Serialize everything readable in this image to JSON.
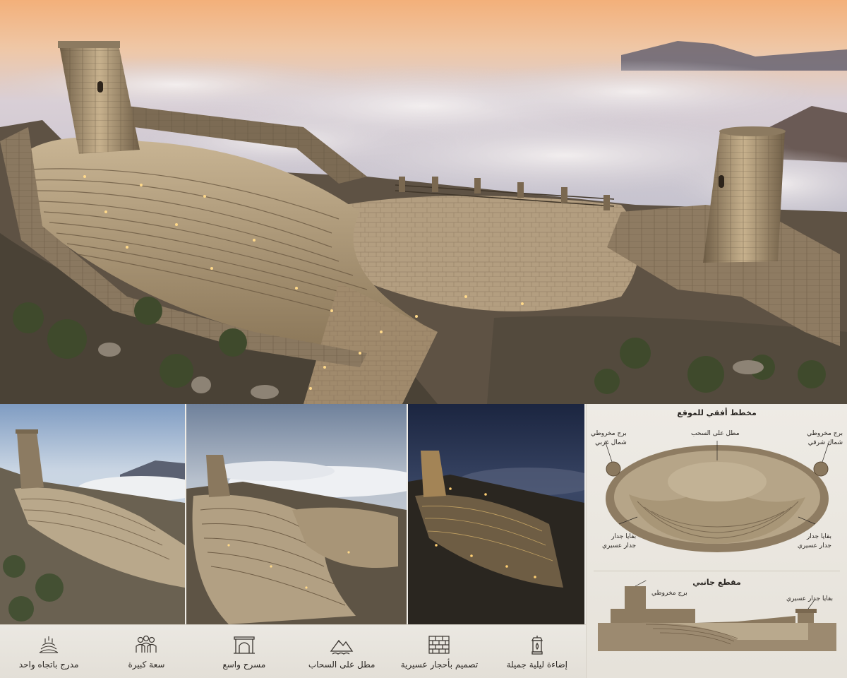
{
  "plan_panel": {
    "top_view_title": "مخطط أفقي للموقع",
    "tower_nw_label": [
      "برج مخروطي",
      "شمال غربي"
    ],
    "cloud_view_label": "مطل على السحب",
    "tower_ne_label": [
      "برج مخروطي",
      "شمال شرقي"
    ],
    "wall_left_label": [
      "بقايا جدار",
      "جدار عسيري"
    ],
    "wall_right_label": [
      "بقايا جدار",
      "جدار عسيري"
    ],
    "section_title": "مقطع جانبي",
    "section_tower_label": "برج مخروطي",
    "section_wall_label": "بقايا جدار عسيري"
  },
  "features": [
    {
      "icon": "lantern-icon",
      "label": "إضاءة ليلية جميلة"
    },
    {
      "icon": "stone-wall-icon",
      "label": "تصميم بأحجار عسيرية"
    },
    {
      "icon": "mountain-clouds-icon",
      "label": "مطل على السحاب"
    },
    {
      "icon": "stage-arch-icon",
      "label": "مسرح واسع"
    },
    {
      "icon": "audience-icon",
      "label": "سعة كبيرة"
    },
    {
      "icon": "amphitheater-icon",
      "label": "مدرج باتجاه واحد"
    }
  ],
  "colors": {
    "stone": "#b59e7e",
    "stone_dark": "#6e5c46",
    "sunset_top": "#f2b27c",
    "cloud": "#e9e4e4",
    "night_sky": "#1f2a44",
    "panel_bg": "#eeebe5",
    "text": "#2a2622"
  }
}
